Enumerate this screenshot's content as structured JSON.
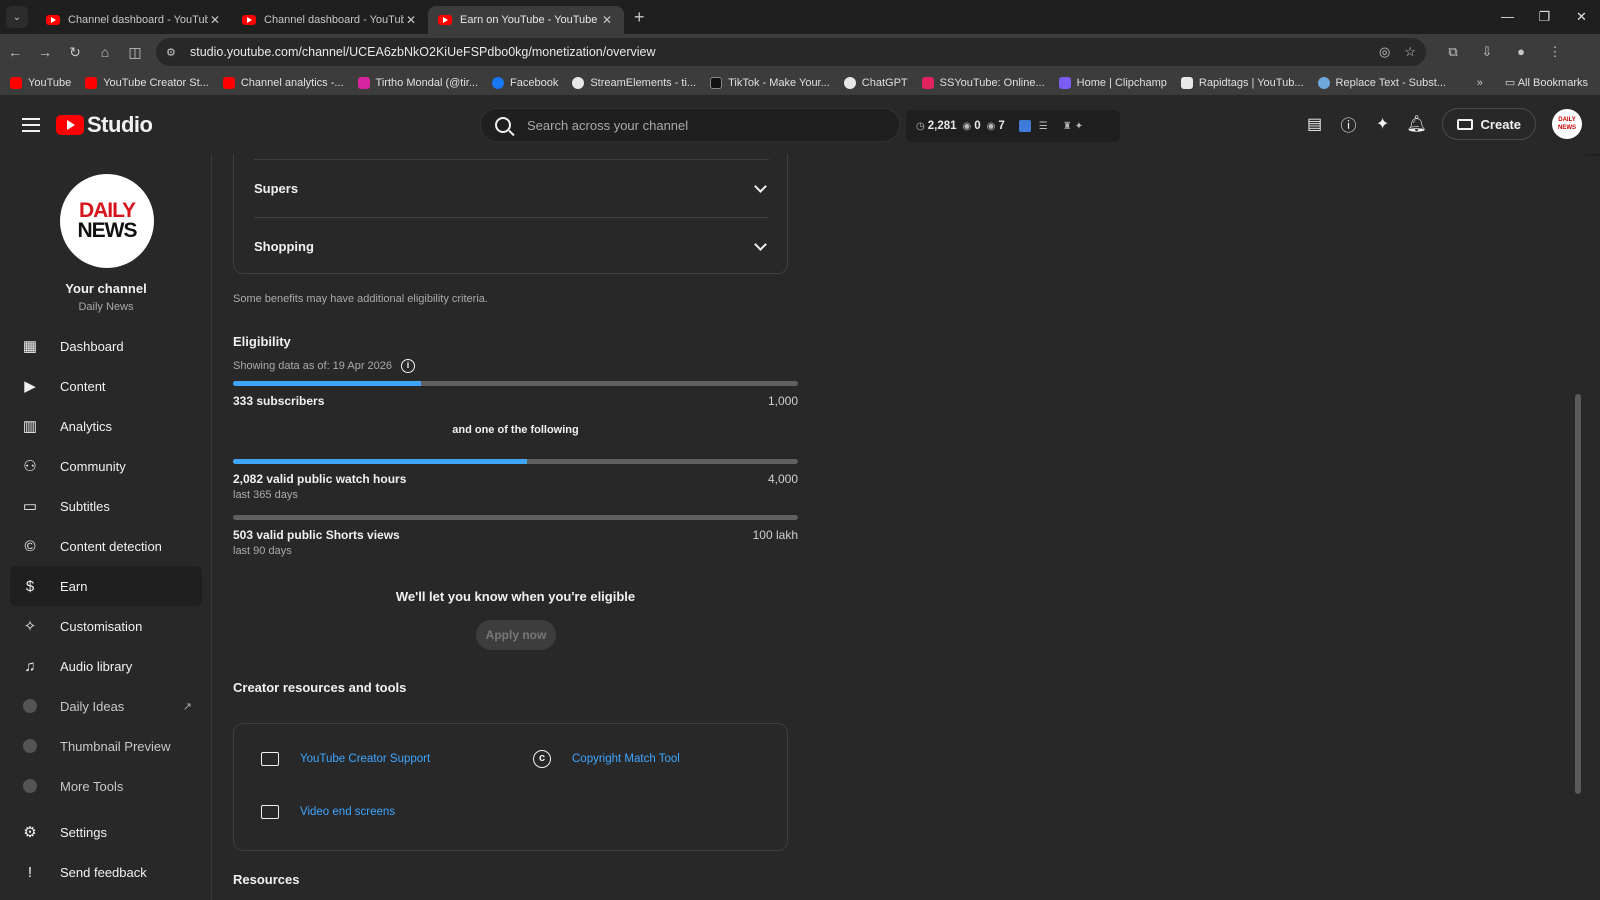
{
  "browser": {
    "tabs": [
      {
        "title": "Channel dashboard - YouTube"
      },
      {
        "title": "Channel dashboard - YouTube"
      },
      {
        "title": "Earn on YouTube - YouTube Stu"
      }
    ],
    "url": "studio.youtube.com/channel/UCEA6zbNkO2KiUeFSPdbo0kg/monetization/overview",
    "bookmarks": [
      {
        "label": "YouTube",
        "color": "#ff0000"
      },
      {
        "label": "YouTube Creator St...",
        "color": "#ff0000"
      },
      {
        "label": "Channel analytics -...",
        "color": "#ff0000"
      },
      {
        "label": "Tirtho Mondal (@tir...",
        "color": "#d6249f"
      },
      {
        "label": "Facebook",
        "color": "#1877f2"
      },
      {
        "label": "StreamElements - ti...",
        "color": "#e8e8e8"
      },
      {
        "label": "TikTok - Make Your...",
        "color": "#111111"
      },
      {
        "label": "ChatGPT",
        "color": "#e8e8e8"
      },
      {
        "label": "SSYouTube: Online...",
        "color": "#e0245e"
      },
      {
        "label": "Home | Clipchamp",
        "color": "#7b5cf5"
      },
      {
        "label": "Rapidtags | YouTub...",
        "color": "#e8e8e8"
      },
      {
        "label": "Replace Text - Subst...",
        "color": "#6fa8dc"
      }
    ],
    "all_bookmarks": "All Bookmarks"
  },
  "header": {
    "logo_text": "Studio",
    "search_placeholder": "Search across your channel",
    "stats": {
      "a": "2,281",
      "b": "0",
      "c": "7"
    },
    "create_label": "Create"
  },
  "sidebar": {
    "avatar_line1": "DAILY",
    "avatar_line2": "NEWS",
    "channel_title": "Your channel",
    "channel_name": "Daily News",
    "items": [
      {
        "label": "Dashboard",
        "icon": "dashboard-icon"
      },
      {
        "label": "Content",
        "icon": "content-icon"
      },
      {
        "label": "Analytics",
        "icon": "analytics-icon"
      },
      {
        "label": "Community",
        "icon": "community-icon"
      },
      {
        "label": "Subtitles",
        "icon": "subtitles-icon"
      },
      {
        "label": "Content detection",
        "icon": "copyright-icon"
      },
      {
        "label": "Earn",
        "icon": "dollar-icon"
      },
      {
        "label": "Customisation",
        "icon": "wand-icon"
      },
      {
        "label": "Audio library",
        "icon": "audio-library-icon"
      },
      {
        "label": "Daily Ideas",
        "icon": "plugin-icon"
      },
      {
        "label": "Thumbnail Preview",
        "icon": "plugin-icon"
      },
      {
        "label": "More Tools",
        "icon": "plugin-icon"
      }
    ],
    "settings_label": "Settings",
    "feedback_label": "Send feedback"
  },
  "main": {
    "accordion": [
      {
        "label": "Supers"
      },
      {
        "label": "Shopping"
      }
    ],
    "note": "Some benefits may have additional eligibility criteria.",
    "eligibility_title": "Eligibility",
    "data_as_of": "Showing data as of: 19 Apr 2026",
    "subscribers": {
      "label": "333 subscribers",
      "target": "1,000",
      "progress": 0.333
    },
    "or_text": "and one of the following",
    "watch_hours": {
      "label": "2,082 valid public watch hours",
      "target": "4,000",
      "sub": "last 365 days",
      "progress": 0.52
    },
    "shorts_views": {
      "label": "503 valid public Shorts views",
      "target": "100 lakh",
      "sub": "last 90 days",
      "progress": 0.0
    },
    "eligible_msg": "We'll let you know when you're eligible",
    "apply_label": "Apply now",
    "resources_title": "Creator resources and tools",
    "resources": [
      {
        "label": "YouTube Creator Support",
        "icon": "message-icon"
      },
      {
        "label": "Copyright Match Tool",
        "icon": "copyright-icon"
      },
      {
        "label": "Video end screens",
        "icon": "end-screen-icon"
      }
    ],
    "bottom_title": "Resources"
  },
  "colors": {
    "accent": "#3ea6ff",
    "brand": "#ff0000",
    "background": "#282828"
  }
}
